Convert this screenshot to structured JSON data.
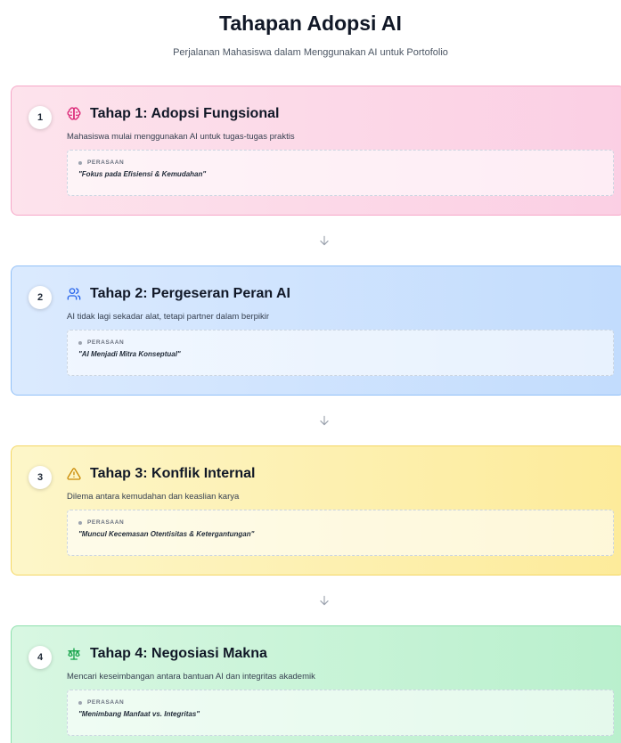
{
  "header": {
    "title": "Tahapan Adopsi AI",
    "subtitle": "Perjalanan Mahasiswa dalam Menggunakan AI untuk Portofolio"
  },
  "stages": [
    {
      "number": "1",
      "icon": "brain-icon",
      "icon_color": "#db2777",
      "title": "Tahap 1: Adopsi Fungsional",
      "description": "Mahasiswa mulai menggunakan AI untuk tugas-tugas praktis",
      "feeling_label": "PERASAAN",
      "feeling_quote": "\"Fokus pada Efisiensi & Kemudahan\""
    },
    {
      "number": "2",
      "icon": "users-icon",
      "icon_color": "#2563eb",
      "title": "Tahap 2: Pergeseran Peran AI",
      "description": "AI tidak lagi sekadar alat, tetapi partner dalam berpikir",
      "feeling_label": "PERASAAN",
      "feeling_quote": "\"AI Menjadi Mitra Konseptual\""
    },
    {
      "number": "3",
      "icon": "warning-triangle-icon",
      "icon_color": "#ca8a04",
      "title": "Tahap 3: Konflik Internal",
      "description": "Dilema antara kemudahan dan keaslian karya",
      "feeling_label": "PERASAAN",
      "feeling_quote": "\"Muncul Kecemasan Otentisitas & Ketergantungan\""
    },
    {
      "number": "4",
      "icon": "scale-icon",
      "icon_color": "#16a34a",
      "title": "Tahap 4: Negosiasi Makna",
      "description": "Mencari keseimbangan antara bantuan AI dan integritas akademik",
      "feeling_label": "PERASAAN",
      "feeling_quote": "\"Menimbang Manfaat vs. Integritas\""
    }
  ],
  "connector_icon": "arrow-down-icon",
  "connector_color": "#9ca3af"
}
